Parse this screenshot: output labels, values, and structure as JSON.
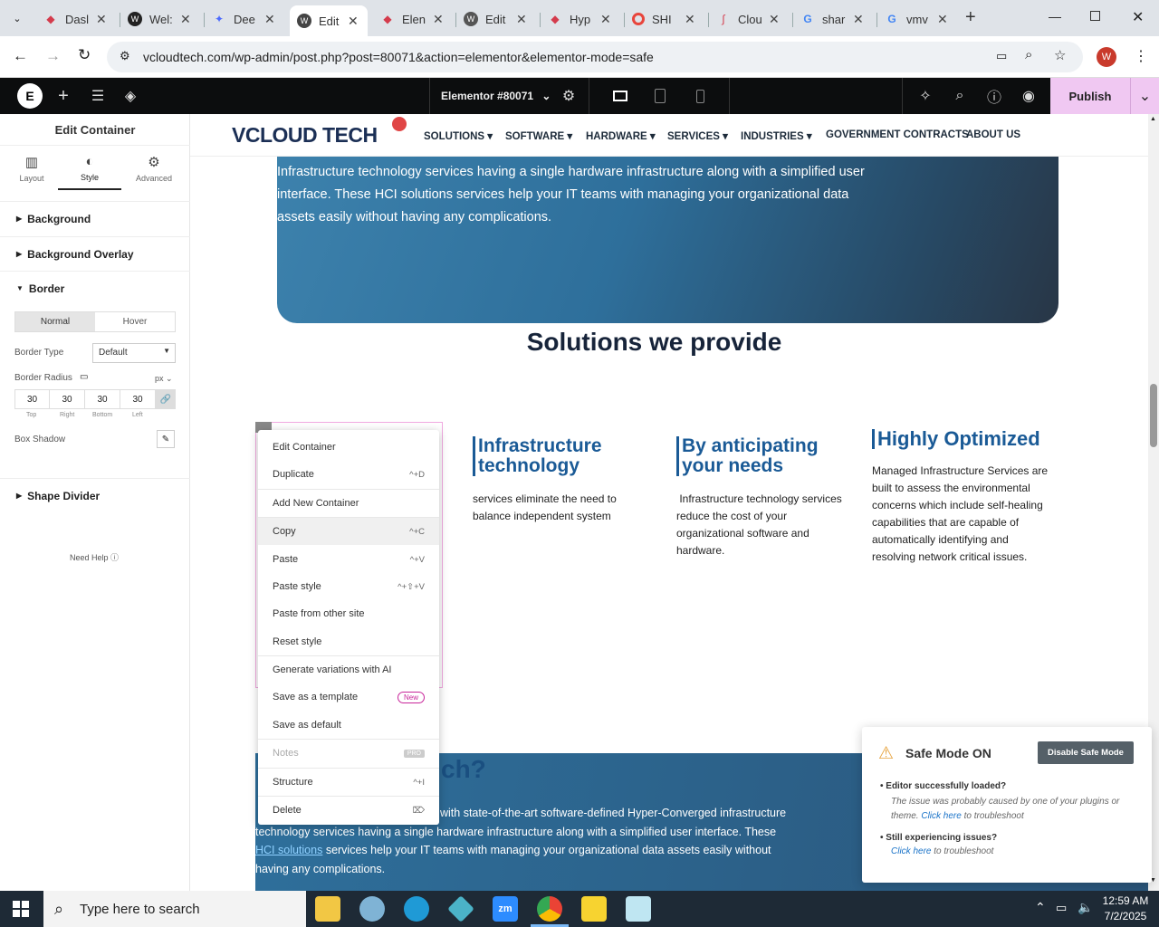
{
  "browser": {
    "tabs": [
      {
        "title": "Dasl",
        "icon": "diamond-red"
      },
      {
        "title": "Wel:",
        "icon": "wordpress"
      },
      {
        "title": "Dee",
        "icon": "deepseek"
      },
      {
        "title": "Edit",
        "icon": "wordpress"
      },
      {
        "title": "Elen",
        "icon": "diamond-red"
      },
      {
        "title": "Edit",
        "icon": "wordpress"
      },
      {
        "title": "Hyp",
        "icon": "diamond-red"
      },
      {
        "title": "SHI",
        "icon": "ring"
      },
      {
        "title": "Clou",
        "icon": "swoosh"
      },
      {
        "title": "shar",
        "icon": "google"
      },
      {
        "title": "vmv",
        "icon": "google"
      }
    ],
    "url": "vcloudtech.com/wp-admin/post.php?post=80071&action=elementor&elementor-mode=safe",
    "profile_initial": "W"
  },
  "elementor": {
    "doc_title": "Elementor #80071",
    "publish": "Publish"
  },
  "panel": {
    "title": "Edit Container",
    "tabs": [
      {
        "label": "Layout"
      },
      {
        "label": "Style"
      },
      {
        "label": "Advanced"
      }
    ],
    "sections": {
      "background": "Background",
      "background_overlay": "Background Overlay",
      "border": "Border",
      "shape_divider": "Shape Divider"
    },
    "state_toggle": {
      "normal": "Normal",
      "hover": "Hover"
    },
    "border_type_label": "Border Type",
    "border_type_value": "Default",
    "border_radius_label": "Border Radius",
    "unit": "px",
    "radius": [
      {
        "value": "30",
        "label": "Top"
      },
      {
        "value": "30",
        "label": "Right"
      },
      {
        "value": "30",
        "label": "Bottom"
      },
      {
        "value": "30",
        "label": "Left"
      }
    ],
    "box_shadow_label": "Box Shadow",
    "need_help": "Need Help"
  },
  "site": {
    "logo": "VCLOUD TECH",
    "nav": [
      "SOLUTIONS",
      "SOFTWARE",
      "HARDWARE",
      "SERVICES",
      "INDUSTRIES",
      "GOVERNMENT CONTRACTS",
      "ABOUT US"
    ],
    "hero_text_lines": [
      "Infrastructure technology services having a single hardware infrastructure along with a simplified user",
      "interface. These HCI solutions services help your IT teams with managing your organizational data",
      "assets easily without having any complications."
    ],
    "section_title": "Solutions we provide",
    "columns": [
      {
        "heading": "Infrastructure technology",
        "text": "services eliminate the need to balance independent system"
      },
      {
        "heading": "By anticipating your needs",
        "text": " Infrastructure technology services reduce the cost of your organizational software and hardware."
      },
      {
        "heading": "Highly Optimized",
        "text": "Managed Infrastructure Services are built to assess the environmental concerns which include self-healing capabilities that are capable of automatically identifying and resolving network critical issues."
      }
    ],
    "bottom_heading_fragment": "ch?",
    "bottom_line1": "with state-of-the-art software-defined Hyper-Converged infrastructure",
    "bottom_line2": "technology services having a single hardware infrastructure along with a simplified user interface. These",
    "bottom_link": "HCI solutions",
    "bottom_line3": " services help your IT teams with managing your organizational data assets easily without",
    "bottom_line4": "having any complications."
  },
  "context_menu": [
    {
      "label": "Edit Container",
      "shortcut": ""
    },
    {
      "label": "Duplicate",
      "shortcut": "^+D"
    },
    {
      "label": "Add New Container",
      "shortcut": ""
    },
    {
      "label": "Copy",
      "shortcut": "^+C"
    },
    {
      "label": "Paste",
      "shortcut": "^+V"
    },
    {
      "label": "Paste style",
      "shortcut": "^+⇧+V"
    },
    {
      "label": "Paste from other site",
      "shortcut": ""
    },
    {
      "label": "Reset style",
      "shortcut": ""
    },
    {
      "label": "Generate variations with AI",
      "shortcut": ""
    },
    {
      "label": "Save as a template",
      "shortcut": "",
      "badge": "New"
    },
    {
      "label": "Save as default",
      "shortcut": ""
    },
    {
      "label": "Notes",
      "shortcut": "PRO"
    },
    {
      "label": "Structure",
      "shortcut": "^+I"
    },
    {
      "label": "Delete",
      "shortcut": "⌦"
    }
  ],
  "safe_mode": {
    "title": "Safe Mode ON",
    "button": "Disable Safe Mode",
    "item1_title": "Editor successfully loaded?",
    "item1_text": "The issue was probably caused by one of your plugins or theme.",
    "item1_link": "Click here",
    "item1_suffix": " to troubleshoot",
    "item2_title": "Still experiencing issues?",
    "item2_link": "Click here",
    "item2_suffix": " to troubleshoot"
  },
  "taskbar": {
    "search_placeholder": "Type here to search",
    "time": "12:59 AM",
    "date": "7/2/2025"
  },
  "colors": {
    "accent": "#1a5a96",
    "publish": "#f0c8f2",
    "elementor_bar": "#0c0d0e"
  }
}
